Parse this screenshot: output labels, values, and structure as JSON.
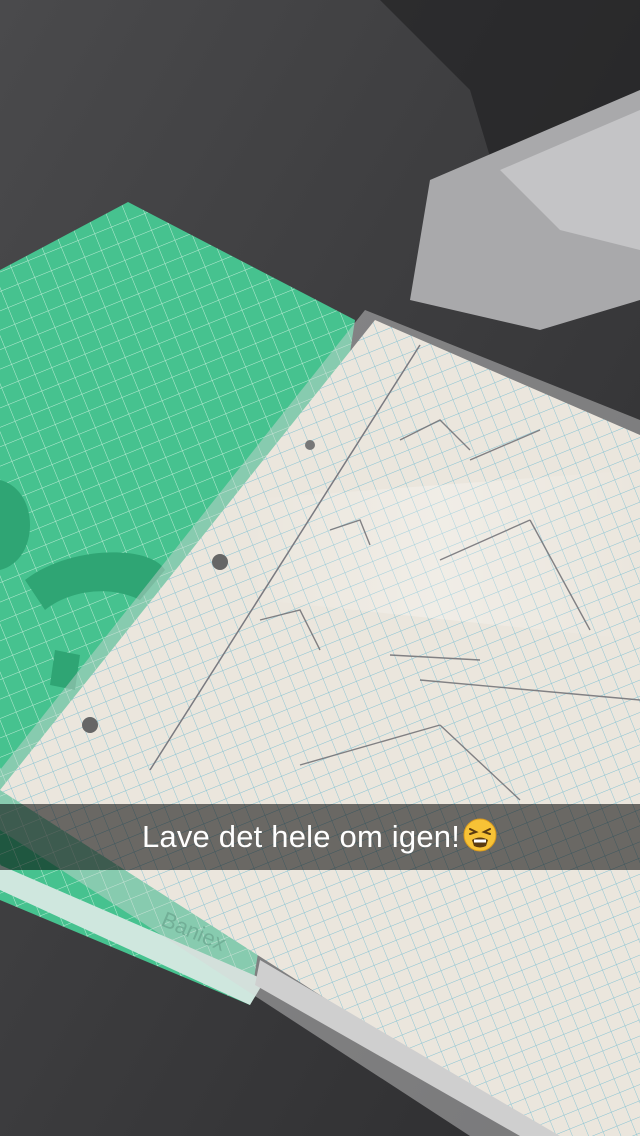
{
  "caption": {
    "text": "Lave det hele om igen!",
    "emoji": "tired-face-emoji"
  },
  "notebook": {
    "brand": "Baniex",
    "color": "#3fbf8a"
  },
  "colors": {
    "background_dark": "#2f2f31",
    "background_light": "#bfbfbf",
    "notebook_green": "#3fbf8a",
    "paper": "#e9e4dc",
    "grid_line": "#8fc9d6"
  }
}
